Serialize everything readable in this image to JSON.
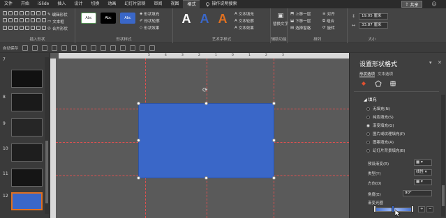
{
  "ribbon_tabs": [
    "文件",
    "开始",
    "iSlide",
    "插入",
    "设计",
    "切换",
    "动画",
    "幻灯片放映",
    "审阅",
    "视图",
    "格式"
  ],
  "active_tab": "格式",
  "search_label": "操作说明搜索",
  "share_label": "共享",
  "groups": {
    "insert_shapes": {
      "label": "插入形状",
      "edit_shape": "编辑形状",
      "text_box": "文本框",
      "merge_shapes": "合并形状"
    },
    "shape_styles": {
      "label": "形状样式",
      "swatch_text": "Abc",
      "fill": "形状填充",
      "outline": "形状轮廓",
      "effects": "形状效果"
    },
    "wordart": {
      "label": "艺术字样式",
      "letter": "A",
      "text_fill": "文本填充",
      "text_outline": "文本轮廓",
      "text_effects": "文本效果"
    },
    "accessibility": {
      "label": "辅助功能",
      "alt_text": "替换文字"
    },
    "arrange": {
      "label": "排列",
      "bring_forward": "上移一层",
      "send_backward": "下移一层",
      "selection_pane": "选择窗格",
      "align": "对齐",
      "group": "组合",
      "rotate": "旋转"
    },
    "size": {
      "label": "大小",
      "height": "19.05 厘米",
      "width": "33.87 厘米"
    }
  },
  "qbar": {
    "autosave": "自动保存"
  },
  "thumbnails": [
    {
      "num": "7",
      "title": ""
    },
    {
      "num": "8",
      "title": ""
    },
    {
      "num": "9",
      "title": ""
    },
    {
      "num": "10",
      "title": ""
    },
    {
      "num": "11",
      "title": ""
    },
    {
      "num": "12",
      "title": ""
    }
  ],
  "ruler_ticks": [
    "5",
    "4",
    "3",
    "2",
    "1",
    "0",
    "1",
    "2",
    "3"
  ],
  "pane": {
    "title": "设置形状格式",
    "subtab_shape": "形状选项",
    "subtab_text": "文本选项",
    "fill_section": "填充",
    "fill_options": [
      "无填充(N)",
      "纯色填充(S)",
      "渐变填充(G)",
      "图片或纹理填充(P)",
      "图案填充(A)",
      "幻灯片背景填充(B)"
    ],
    "selected_fill": "渐变填充(G)",
    "preset_label": "预设渐变(R)",
    "type_label": "类型(Y)",
    "type_value": "线性",
    "direction_label": "方向(D)",
    "angle_label": "角度(E)",
    "angle_value": "90°",
    "stops_label": "渐变光圈"
  },
  "colors": {
    "shape_fill": "#3a67c8",
    "guide": "#e05050",
    "active_thumb_border": "#e07020"
  }
}
